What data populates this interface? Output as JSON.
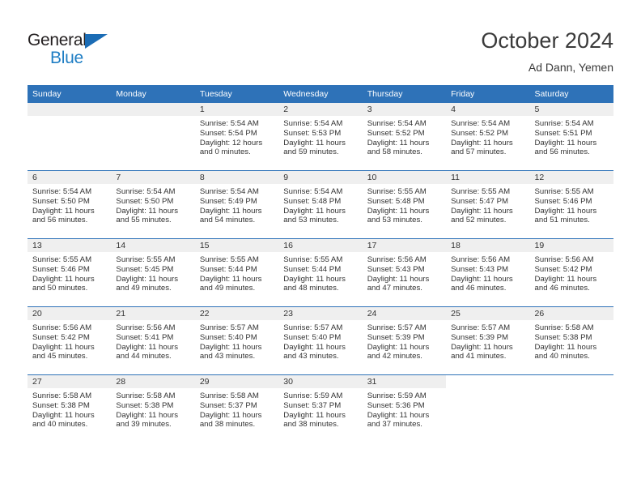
{
  "brand": {
    "word1": "General",
    "word2": "Blue",
    "triangle_color": "#1b6cb5",
    "blue_color": "#1f7ec4"
  },
  "header": {
    "title": "October 2024",
    "subtitle": "Ad Dann, Yemen"
  },
  "theme": {
    "header_blue": "#2e72b8",
    "daynum_band": "#efefef",
    "text": "#333333"
  },
  "calendar": {
    "weekday_headers": [
      "Sunday",
      "Monday",
      "Tuesday",
      "Wednesday",
      "Thursday",
      "Friday",
      "Saturday"
    ],
    "weeks": [
      [
        {
          "day": "",
          "sunrise": "",
          "sunset": "",
          "daylight": "",
          "empty": true
        },
        {
          "day": "",
          "sunrise": "",
          "sunset": "",
          "daylight": "",
          "empty": true
        },
        {
          "day": "1",
          "sunrise": "Sunrise: 5:54 AM",
          "sunset": "Sunset: 5:54 PM",
          "daylight": "Daylight: 12 hours and 0 minutes."
        },
        {
          "day": "2",
          "sunrise": "Sunrise: 5:54 AM",
          "sunset": "Sunset: 5:53 PM",
          "daylight": "Daylight: 11 hours and 59 minutes."
        },
        {
          "day": "3",
          "sunrise": "Sunrise: 5:54 AM",
          "sunset": "Sunset: 5:52 PM",
          "daylight": "Daylight: 11 hours and 58 minutes."
        },
        {
          "day": "4",
          "sunrise": "Sunrise: 5:54 AM",
          "sunset": "Sunset: 5:52 PM",
          "daylight": "Daylight: 11 hours and 57 minutes."
        },
        {
          "day": "5",
          "sunrise": "Sunrise: 5:54 AM",
          "sunset": "Sunset: 5:51 PM",
          "daylight": "Daylight: 11 hours and 56 minutes."
        }
      ],
      [
        {
          "day": "6",
          "sunrise": "Sunrise: 5:54 AM",
          "sunset": "Sunset: 5:50 PM",
          "daylight": "Daylight: 11 hours and 56 minutes."
        },
        {
          "day": "7",
          "sunrise": "Sunrise: 5:54 AM",
          "sunset": "Sunset: 5:50 PM",
          "daylight": "Daylight: 11 hours and 55 minutes."
        },
        {
          "day": "8",
          "sunrise": "Sunrise: 5:54 AM",
          "sunset": "Sunset: 5:49 PM",
          "daylight": "Daylight: 11 hours and 54 minutes."
        },
        {
          "day": "9",
          "sunrise": "Sunrise: 5:54 AM",
          "sunset": "Sunset: 5:48 PM",
          "daylight": "Daylight: 11 hours and 53 minutes."
        },
        {
          "day": "10",
          "sunrise": "Sunrise: 5:55 AM",
          "sunset": "Sunset: 5:48 PM",
          "daylight": "Daylight: 11 hours and 53 minutes."
        },
        {
          "day": "11",
          "sunrise": "Sunrise: 5:55 AM",
          "sunset": "Sunset: 5:47 PM",
          "daylight": "Daylight: 11 hours and 52 minutes."
        },
        {
          "day": "12",
          "sunrise": "Sunrise: 5:55 AM",
          "sunset": "Sunset: 5:46 PM",
          "daylight": "Daylight: 11 hours and 51 minutes."
        }
      ],
      [
        {
          "day": "13",
          "sunrise": "Sunrise: 5:55 AM",
          "sunset": "Sunset: 5:46 PM",
          "daylight": "Daylight: 11 hours and 50 minutes."
        },
        {
          "day": "14",
          "sunrise": "Sunrise: 5:55 AM",
          "sunset": "Sunset: 5:45 PM",
          "daylight": "Daylight: 11 hours and 49 minutes."
        },
        {
          "day": "15",
          "sunrise": "Sunrise: 5:55 AM",
          "sunset": "Sunset: 5:44 PM",
          "daylight": "Daylight: 11 hours and 49 minutes."
        },
        {
          "day": "16",
          "sunrise": "Sunrise: 5:55 AM",
          "sunset": "Sunset: 5:44 PM",
          "daylight": "Daylight: 11 hours and 48 minutes."
        },
        {
          "day": "17",
          "sunrise": "Sunrise: 5:56 AM",
          "sunset": "Sunset: 5:43 PM",
          "daylight": "Daylight: 11 hours and 47 minutes."
        },
        {
          "day": "18",
          "sunrise": "Sunrise: 5:56 AM",
          "sunset": "Sunset: 5:43 PM",
          "daylight": "Daylight: 11 hours and 46 minutes."
        },
        {
          "day": "19",
          "sunrise": "Sunrise: 5:56 AM",
          "sunset": "Sunset: 5:42 PM",
          "daylight": "Daylight: 11 hours and 46 minutes."
        }
      ],
      [
        {
          "day": "20",
          "sunrise": "Sunrise: 5:56 AM",
          "sunset": "Sunset: 5:42 PM",
          "daylight": "Daylight: 11 hours and 45 minutes."
        },
        {
          "day": "21",
          "sunrise": "Sunrise: 5:56 AM",
          "sunset": "Sunset: 5:41 PM",
          "daylight": "Daylight: 11 hours and 44 minutes."
        },
        {
          "day": "22",
          "sunrise": "Sunrise: 5:57 AM",
          "sunset": "Sunset: 5:40 PM",
          "daylight": "Daylight: 11 hours and 43 minutes."
        },
        {
          "day": "23",
          "sunrise": "Sunrise: 5:57 AM",
          "sunset": "Sunset: 5:40 PM",
          "daylight": "Daylight: 11 hours and 43 minutes."
        },
        {
          "day": "24",
          "sunrise": "Sunrise: 5:57 AM",
          "sunset": "Sunset: 5:39 PM",
          "daylight": "Daylight: 11 hours and 42 minutes."
        },
        {
          "day": "25",
          "sunrise": "Sunrise: 5:57 AM",
          "sunset": "Sunset: 5:39 PM",
          "daylight": "Daylight: 11 hours and 41 minutes."
        },
        {
          "day": "26",
          "sunrise": "Sunrise: 5:58 AM",
          "sunset": "Sunset: 5:38 PM",
          "daylight": "Daylight: 11 hours and 40 minutes."
        }
      ],
      [
        {
          "day": "27",
          "sunrise": "Sunrise: 5:58 AM",
          "sunset": "Sunset: 5:38 PM",
          "daylight": "Daylight: 11 hours and 40 minutes."
        },
        {
          "day": "28",
          "sunrise": "Sunrise: 5:58 AM",
          "sunset": "Sunset: 5:38 PM",
          "daylight": "Daylight: 11 hours and 39 minutes."
        },
        {
          "day": "29",
          "sunrise": "Sunrise: 5:58 AM",
          "sunset": "Sunset: 5:37 PM",
          "daylight": "Daylight: 11 hours and 38 minutes."
        },
        {
          "day": "30",
          "sunrise": "Sunrise: 5:59 AM",
          "sunset": "Sunset: 5:37 PM",
          "daylight": "Daylight: 11 hours and 38 minutes."
        },
        {
          "day": "31",
          "sunrise": "Sunrise: 5:59 AM",
          "sunset": "Sunset: 5:36 PM",
          "daylight": "Daylight: 11 hours and 37 minutes."
        },
        {
          "day": "",
          "sunrise": "",
          "sunset": "",
          "daylight": "",
          "blank": true
        },
        {
          "day": "",
          "sunrise": "",
          "sunset": "",
          "daylight": "",
          "blank": true
        }
      ]
    ]
  }
}
